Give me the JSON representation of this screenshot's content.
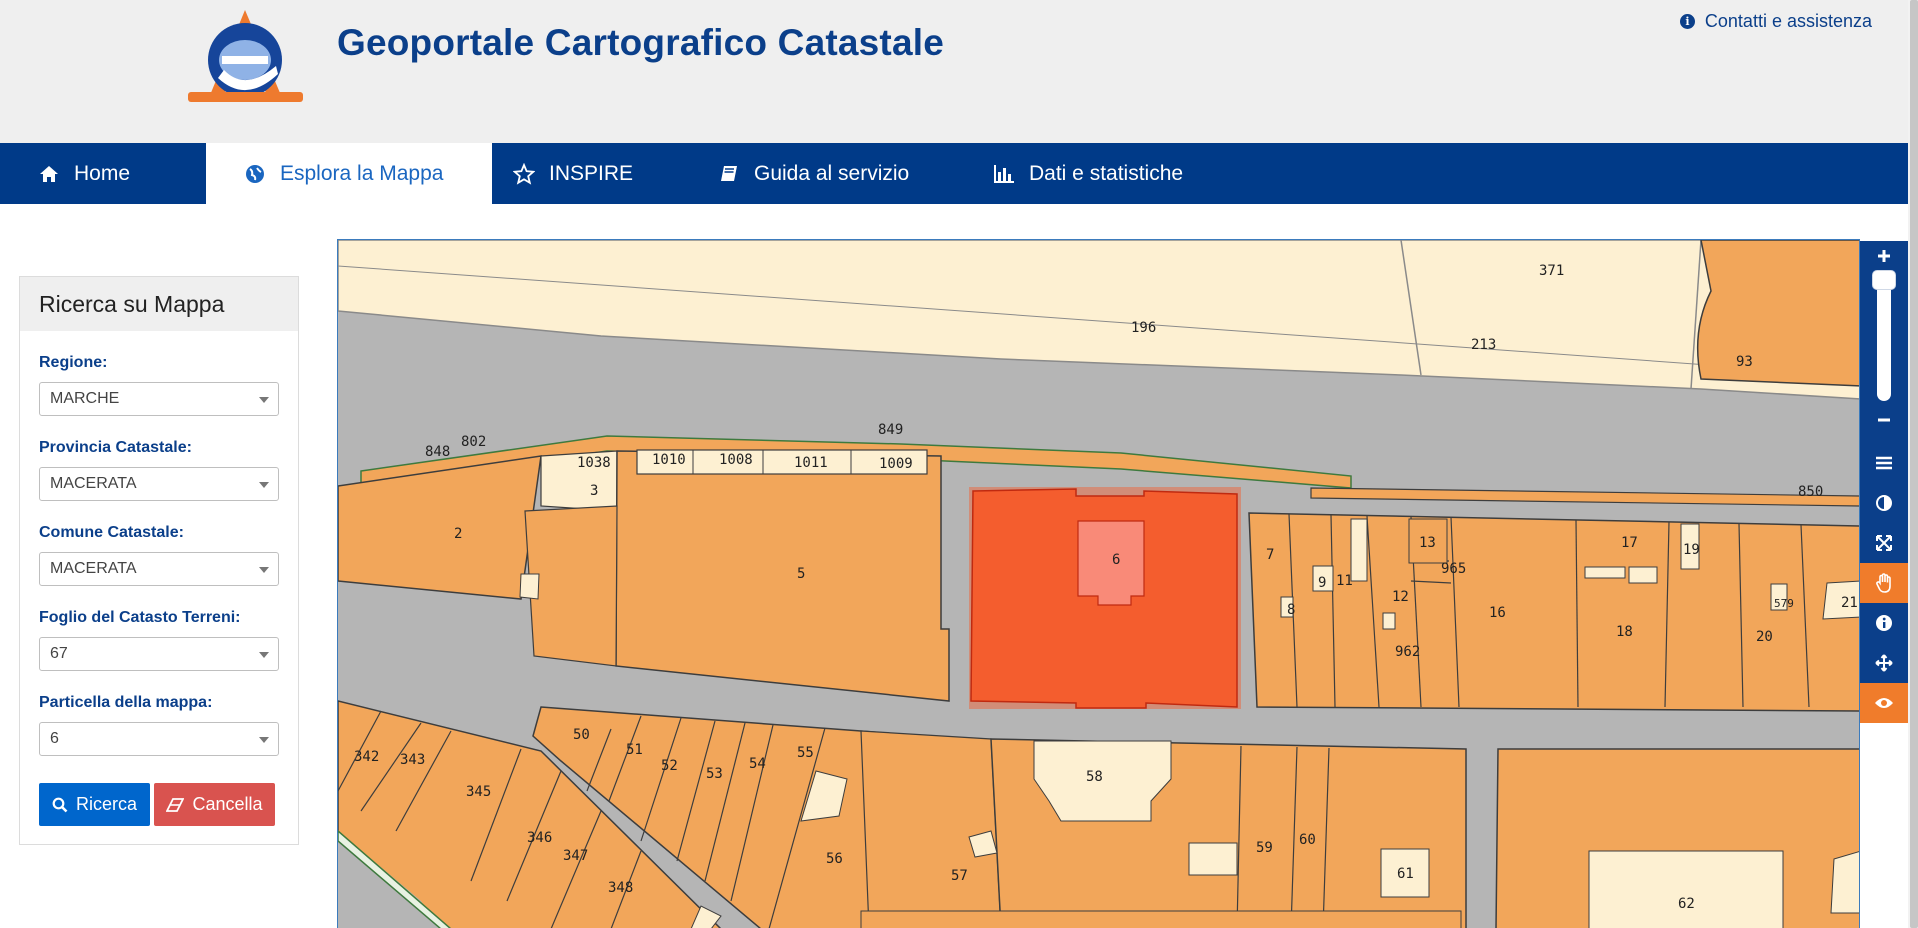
{
  "header": {
    "title": "Geoportale Cartografico Catastale",
    "contact_label": "Contatti e assistenza"
  },
  "nav": [
    {
      "label": "Home",
      "icon": "home-icon",
      "active": false
    },
    {
      "label": "Esplora la Mappa",
      "icon": "globe-icon",
      "active": true
    },
    {
      "label": "INSPIRE",
      "icon": "star-icon",
      "active": false
    },
    {
      "label": "Guida al servizio",
      "icon": "book-icon",
      "active": false
    },
    {
      "label": "Dati e statistiche",
      "icon": "bar-chart-icon",
      "active": false
    }
  ],
  "search_panel": {
    "title": "Ricerca su Mappa",
    "fields": [
      {
        "label": "Regione:",
        "value": "MARCHE"
      },
      {
        "label": "Provincia Catastale:",
        "value": "MACERATA"
      },
      {
        "label": "Comune Catastale:",
        "value": "MACERATA"
      },
      {
        "label": "Foglio del Catasto Terreni:",
        "value": "67"
      },
      {
        "label": "Particella della mappa:",
        "value": "6"
      }
    ],
    "search_label": "Ricerca",
    "cancel_label": "Cancella"
  },
  "map": {
    "selected_parcel": "6",
    "colors": {
      "parcel": "#f2a65a",
      "light_parcel": "#fdf0d2",
      "road": "#b5b5b5",
      "selected": "#f45d2e",
      "selected_inner": "#f98a78",
      "outline": "#3d3d3d"
    },
    "parcel_labels": [
      "371",
      "196",
      "213",
      "93",
      "849",
      "848",
      "802",
      "1038",
      "1010",
      "1008",
      "1011",
      "1009",
      "3",
      "2",
      "5",
      "6",
      "7",
      "13",
      "965",
      "17",
      "19",
      "850",
      "9",
      "11",
      "12",
      "16",
      "8",
      "962",
      "18",
      "20",
      "21",
      "579",
      "342",
      "343",
      "345",
      "50",
      "51",
      "52",
      "53",
      "54",
      "55",
      "58",
      "346",
      "347",
      "348",
      "56",
      "57",
      "59",
      "60",
      "61",
      "62"
    ]
  },
  "toolbar": {
    "tools": [
      "zoom-in-icon",
      "zoom-out-icon",
      "layers-icon",
      "contrast-icon",
      "fullscreen-icon",
      "pan-hand-icon",
      "info-icon",
      "move-icon",
      "eye-icon"
    ]
  }
}
